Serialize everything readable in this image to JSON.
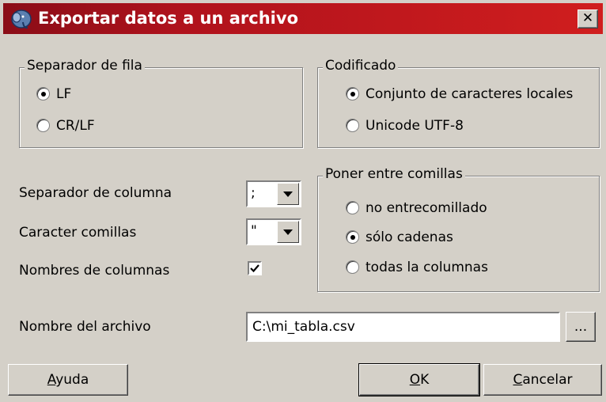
{
  "window": {
    "title": "Exportar datos a un archivo",
    "close_glyph": "✕",
    "icon": "elephant-icon"
  },
  "row_separator": {
    "legend": "Separador de fila",
    "options": [
      {
        "label": "LF",
        "checked": true
      },
      {
        "label": "CR/LF",
        "checked": false
      }
    ]
  },
  "encoding": {
    "legend": "Codificado",
    "options": [
      {
        "label": "Conjunto de caracteres locales",
        "checked": true
      },
      {
        "label": "Unicode UTF-8",
        "checked": false
      }
    ]
  },
  "column_separator": {
    "label": "Separador de columna",
    "value": ";"
  },
  "quote_char": {
    "label": "Caracter comillas",
    "value": "\""
  },
  "column_names": {
    "label": "Nombres de columnas",
    "checked": true
  },
  "quoting": {
    "legend": "Poner entre comillas",
    "options": [
      {
        "label": "no entrecomillado",
        "checked": false
      },
      {
        "label": "sólo cadenas",
        "checked": true
      },
      {
        "label": "todas la columnas",
        "checked": false
      }
    ]
  },
  "file": {
    "label": "Nombre del archivo",
    "value": "C:\\mi_tabla.csv",
    "browse_label": "..."
  },
  "buttons": {
    "help": {
      "pre": "",
      "u": "A",
      "post": "yuda"
    },
    "ok": {
      "pre": "",
      "u": "O",
      "post": "K"
    },
    "cancel": {
      "pre": "",
      "u": "C",
      "post": "ancelar"
    }
  }
}
